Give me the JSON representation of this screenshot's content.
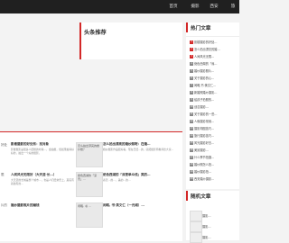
{
  "topbar": {
    "nav": [
      "首页",
      "摄影",
      "西安",
      "旅"
    ]
  },
  "headline_card": {
    "title": "头条推荐"
  },
  "hot_card": {
    "title": "热门文章",
    "items": [
      {
        "num": "1",
        "text": "影楼摄影的好处…"
      },
      {
        "num": "2",
        "text": "怎么拍出漂亮的婚…"
      },
      {
        "num": "3",
        "text": "人间风光无限…"
      },
      {
        "num": "4",
        "text": "绝色西湖的「深…"
      },
      {
        "num": "5",
        "text": "婚纱摄影照片…"
      },
      {
        "num": "6",
        "text": "关于摄影的心…"
      },
      {
        "num": "7",
        "text": "闲暇,书·美文仁…"
      },
      {
        "num": "8",
        "text": "新婚照婚纱摄影…"
      },
      {
        "num": "9",
        "text": "给孩子拍照的…"
      },
      {
        "num": "10",
        "text": "创意摄影…"
      },
      {
        "num": "11",
        "text": "关于摄影的一些…"
      },
      {
        "num": "12",
        "text": "人像摄影常用…"
      },
      {
        "num": "13",
        "text": "摄影构图技巧…"
      },
      {
        "num": "14",
        "text": "旅行摄影技巧…"
      },
      {
        "num": "15",
        "text": "风光摄影好去…"
      },
      {
        "num": "16",
        "text": "美景摄影…"
      },
      {
        "num": "17",
        "text": "什么季节拍摄…"
      },
      {
        "num": "18",
        "text": "婚纱照怎么拍…"
      },
      {
        "num": "19",
        "text": "婚纱摄影拍…"
      },
      {
        "num": "20",
        "text": "西安婚纱摄影…"
      }
    ]
  },
  "random_card": {
    "title": "随机文章",
    "items": [
      "摄影…",
      "摄影…",
      "摄影…"
    ]
  },
  "main_list": {
    "row1": {
      "left_label": "好处",
      "title": "影楼摄影的好处有：找对象",
      "desc": "影楼摄影是很多人结婚的时候…，会拍摄，但如果拍得好好的，拍出一个好的摄影。"
    },
    "row1_thumb_alt": "怎么拍出漂亮的婚纱照？",
    "row1_title2": "怎么拍出漂亮的婚纱照呢：在婚…",
    "row1_desc2": "婚纱摄影作品很好看，现在已经…的，就把摄影师推荐给大家…",
    "row2": {
      "left_label": "限",
      "title": "人间风光无限好（大天涯·长…）",
      "desc": "大天涯的长城是整个城市…，也是人们经常登上，其实有着独有的…"
    },
    "row2_thumb_alt": "绝色西湖的「深景」…",
    "row2_title2": "绝色西湖的「深夜单众线」美的…",
    "row2_desc2": "春天…的…，美的…的…",
    "row3": {
      "left_label": "片的",
      "title": "婚纱摄影照片的赚钱",
      "desc": ""
    },
    "row3_thumb_alt": "闲暇, 书 …",
    "row3_title2": "闲暇, 书·美文仁（一元城）…"
  }
}
